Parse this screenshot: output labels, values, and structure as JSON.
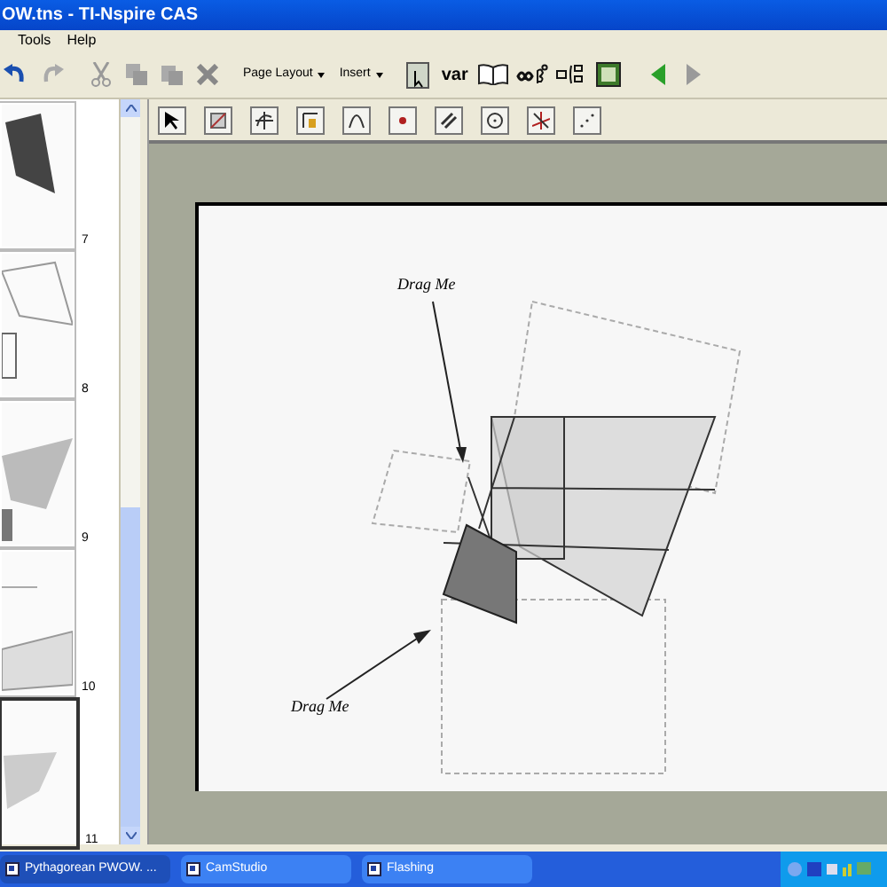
{
  "window": {
    "title": "OW.tns - TI-Nspire CAS"
  },
  "menu": [
    "Tools",
    "Help"
  ],
  "toolbar": {
    "dropdowns": [
      "Page Layout",
      "Insert"
    ],
    "var_label": "var"
  },
  "pages": [
    {
      "number": "7",
      "selected": false
    },
    {
      "number": "8",
      "selected": false
    },
    {
      "number": "9",
      "selected": false
    },
    {
      "number": "10",
      "selected": false
    },
    {
      "number": "11",
      "selected": true
    }
  ],
  "canvas": {
    "labels": [
      "Drag Me",
      "Drag Me"
    ]
  },
  "taskbar": [
    {
      "label": "Pythagorean PWOW. ...",
      "selected": true
    },
    {
      "label": "CamStudio",
      "selected": false
    },
    {
      "label": "Flashing",
      "selected": false
    }
  ]
}
